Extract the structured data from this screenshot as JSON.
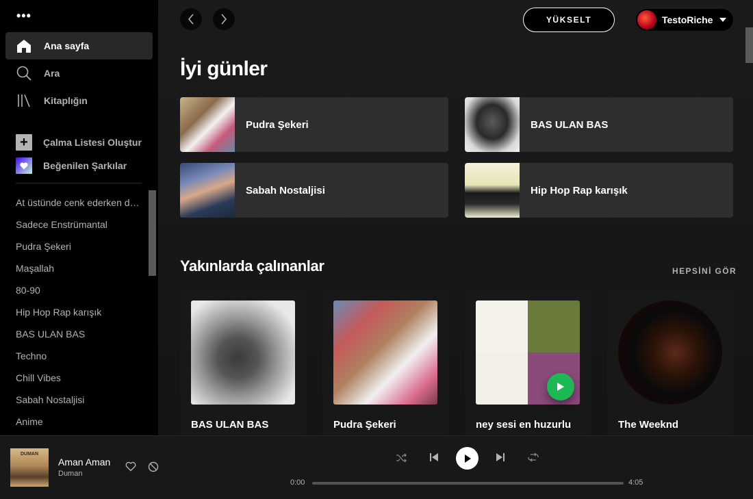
{
  "sidebar": {
    "nav": [
      {
        "label": "Ana sayfa",
        "icon": "home-icon",
        "active": true
      },
      {
        "label": "Ara",
        "icon": "search-icon",
        "active": false
      },
      {
        "label": "Kitaplığın",
        "icon": "library-icon",
        "active": false
      }
    ],
    "create_playlist": "Çalma Listesi Oluştur",
    "liked_songs": "Beğenilen Şarkılar",
    "playlists": [
      "At üstünde cenk ederken düşt",
      "Sadece Enstrümantal",
      "Pudra Şekeri",
      "Maşallah",
      "80-90",
      "Hip Hop Rap karışık",
      "BAS ULAN BAS",
      "Techno",
      "Chill Vibes",
      "Sabah Nostaljisi",
      "Anime"
    ]
  },
  "topbar": {
    "upgrade_label": "YÜKSELT",
    "user_name": "TestoRiche"
  },
  "main": {
    "greeting": "İyi günler",
    "shortcuts": [
      {
        "label": "Pudra Şekeri"
      },
      {
        "label": "BAS ULAN BAS"
      },
      {
        "label": "Sabah Nostaljisi"
      },
      {
        "label": "Hip Hop Rap karışık"
      }
    ],
    "recent_title": "Yakınlarda çalınanlar",
    "see_all": "HEPSİNİ GÖR",
    "recent": [
      {
        "name": "BAS ULAN BAS"
      },
      {
        "name": "Pudra Şekeri"
      },
      {
        "name": "ney sesi en huzurlu"
      },
      {
        "name": "The Weeknd"
      }
    ]
  },
  "player": {
    "title": "Aman Aman",
    "artist": "Duman",
    "cover_text": "DUMAN",
    "time_current": "0:00",
    "time_total": "4:05",
    "progress": 0.0
  },
  "colors": {
    "accent": "#1db954",
    "background": "#121212",
    "sidebar": "#000000",
    "player": "#181818"
  }
}
